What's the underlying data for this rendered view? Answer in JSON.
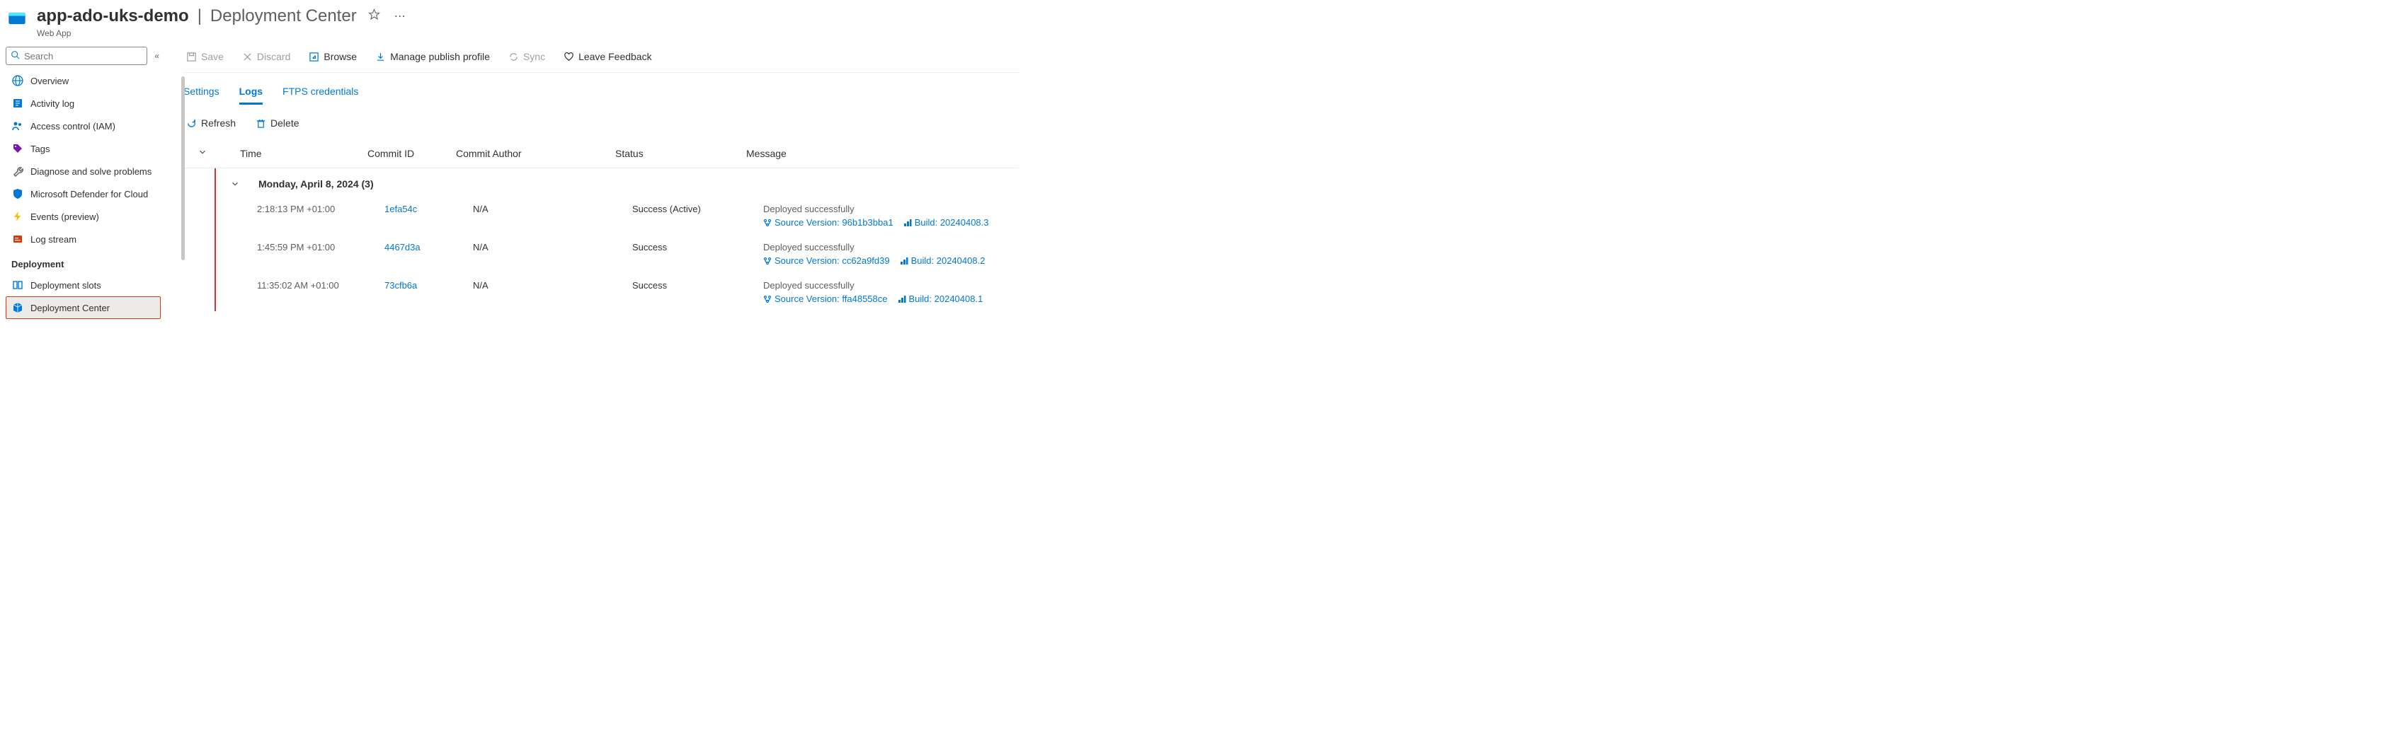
{
  "header": {
    "resource_name": "app-ado-uks-demo",
    "page_title": "Deployment Center",
    "resource_type": "Web App"
  },
  "sidebar": {
    "search_placeholder": "Search",
    "items": [
      {
        "key": "overview",
        "label": "Overview",
        "icon": "globe-icon"
      },
      {
        "key": "activity-log",
        "label": "Activity log",
        "icon": "log-icon"
      },
      {
        "key": "access-control",
        "label": "Access control (IAM)",
        "icon": "people-icon"
      },
      {
        "key": "tags",
        "label": "Tags",
        "icon": "tag-icon"
      },
      {
        "key": "diagnose",
        "label": "Diagnose and solve problems",
        "icon": "wrench-icon"
      },
      {
        "key": "defender",
        "label": "Microsoft Defender for Cloud",
        "icon": "shield-icon"
      },
      {
        "key": "events",
        "label": "Events (preview)",
        "icon": "bolt-icon"
      },
      {
        "key": "log-stream",
        "label": "Log stream",
        "icon": "stream-icon"
      }
    ],
    "section_deployment": "Deployment",
    "deployment_items": [
      {
        "key": "deployment-slots",
        "label": "Deployment slots",
        "icon": "slots-icon",
        "selected": false
      },
      {
        "key": "deployment-center",
        "label": "Deployment Center",
        "icon": "cube-icon",
        "selected": true
      }
    ]
  },
  "toolbar": {
    "save": "Save",
    "discard": "Discard",
    "browse": "Browse",
    "manage_publish_profile": "Manage publish profile",
    "sync": "Sync",
    "leave_feedback": "Leave Feedback"
  },
  "tabs": {
    "settings": "Settings",
    "logs": "Logs",
    "ftps": "FTPS credentials",
    "active": "logs"
  },
  "subtoolbar": {
    "refresh": "Refresh",
    "delete": "Delete"
  },
  "table": {
    "columns": {
      "time": "Time",
      "commit_id": "Commit ID",
      "commit_author": "Commit Author",
      "status": "Status",
      "message": "Message"
    },
    "group": {
      "title": "Monday, April 8, 2024 (3)"
    },
    "rows": [
      {
        "time": "2:18:13 PM +01:00",
        "commit_id": "1efa54c",
        "commit_author": "N/A",
        "status": "Success (Active)",
        "message": "Deployed successfully",
        "source_version_label": "Source Version: 96b1b3bba1",
        "build_label": "Build: 20240408.3"
      },
      {
        "time": "1:45:59 PM +01:00",
        "commit_id": "4467d3a",
        "commit_author": "N/A",
        "status": "Success",
        "message": "Deployed successfully",
        "source_version_label": "Source Version: cc62a9fd39",
        "build_label": "Build: 20240408.2"
      },
      {
        "time": "11:35:02 AM +01:00",
        "commit_id": "73cfb6a",
        "commit_author": "N/A",
        "status": "Success",
        "message": "Deployed successfully",
        "source_version_label": "Source Version: ffa48558ce",
        "build_label": "Build: 20240408.1"
      }
    ]
  }
}
